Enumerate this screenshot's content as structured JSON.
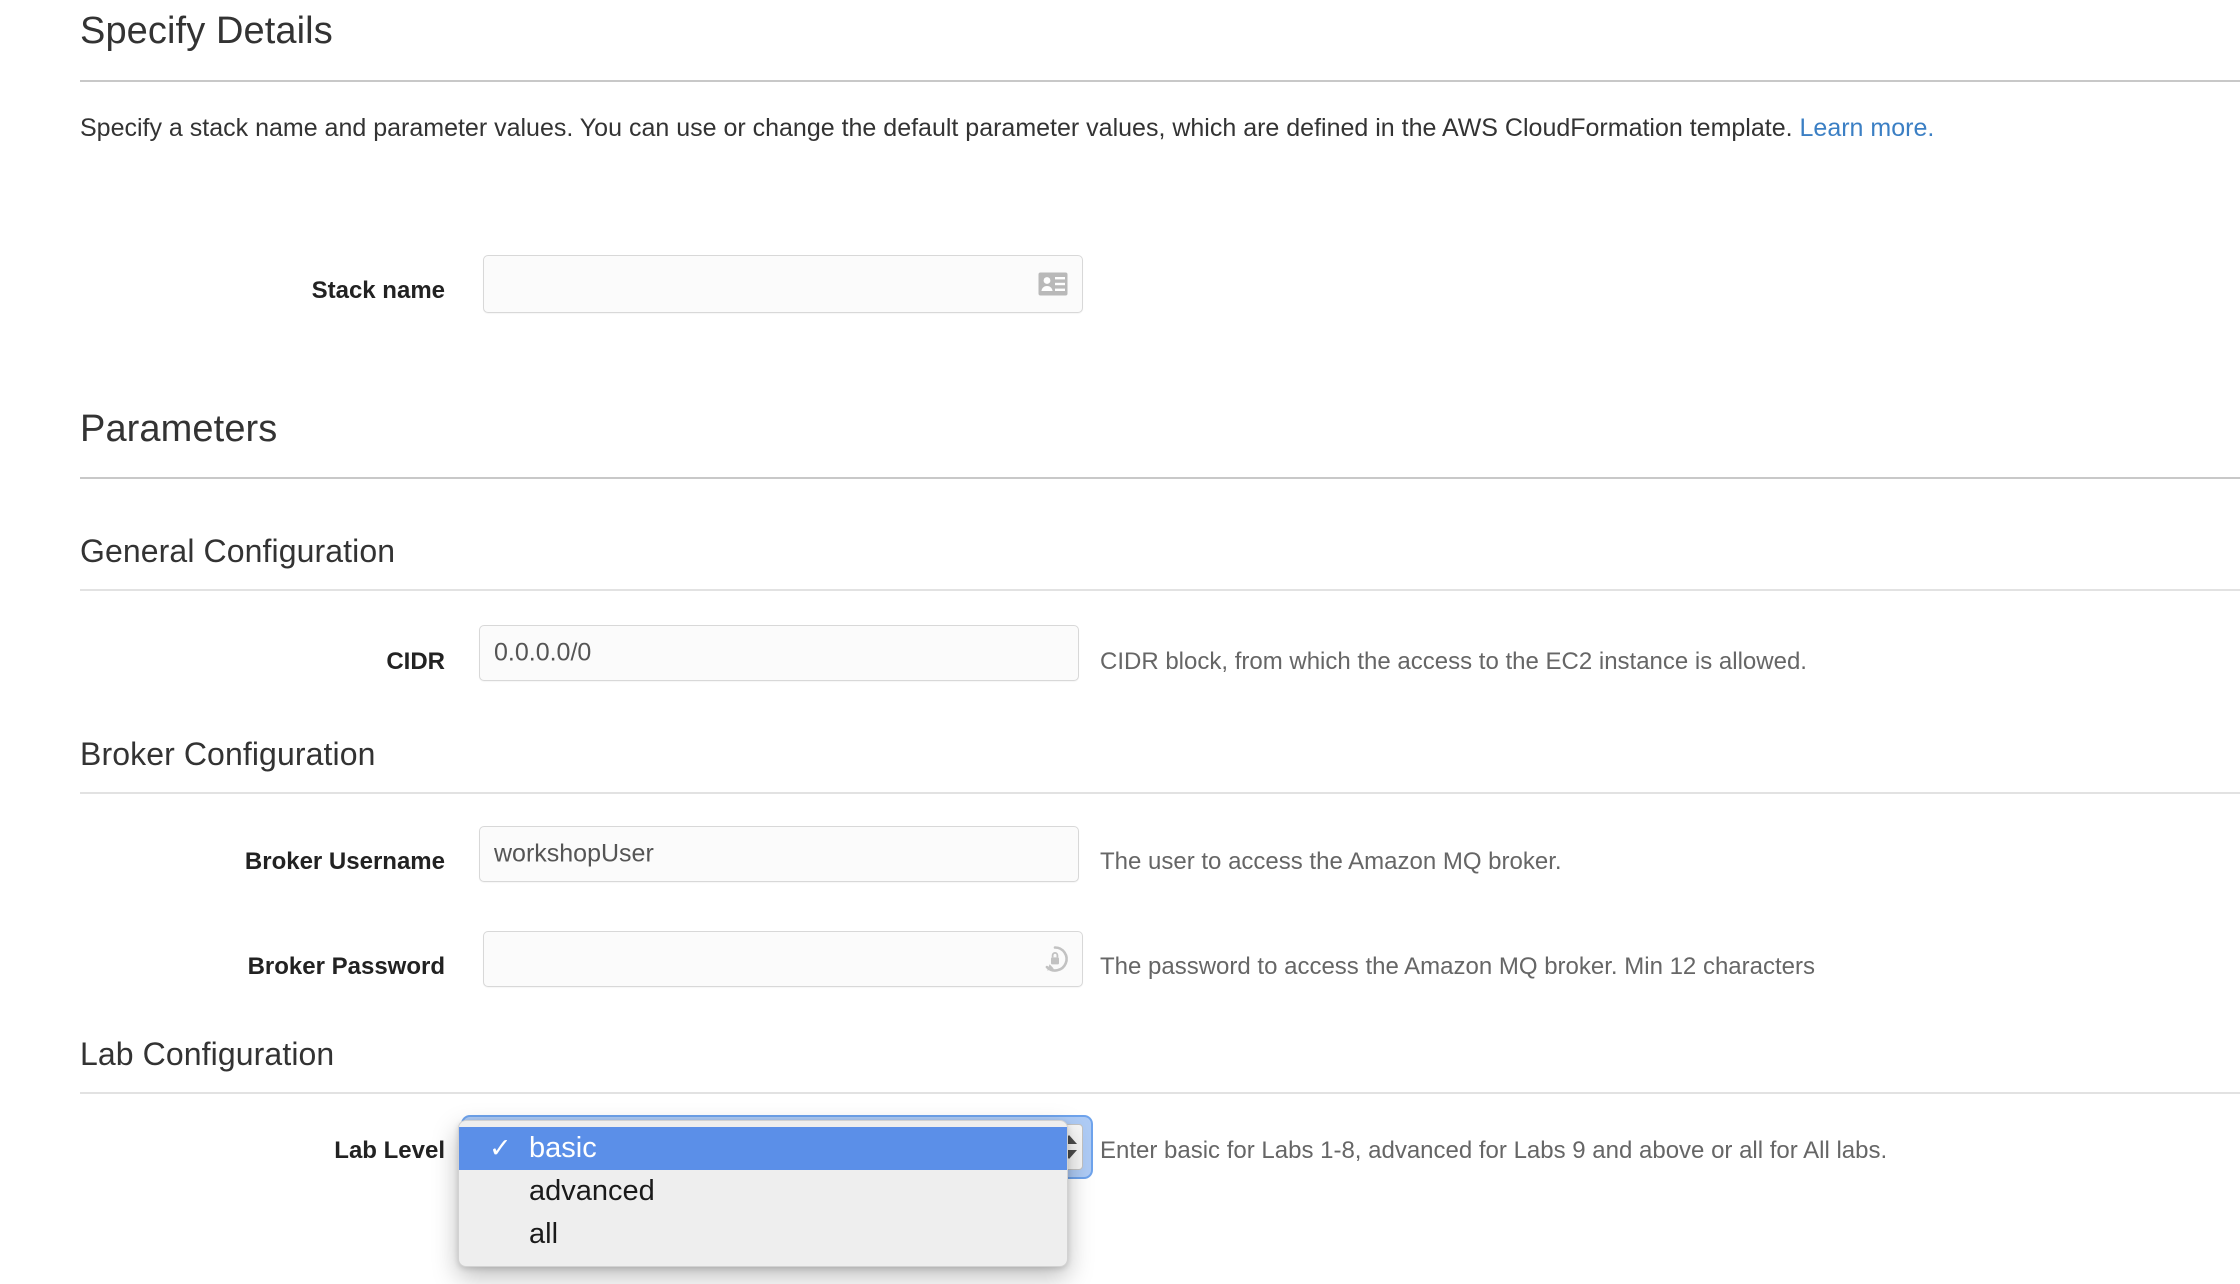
{
  "header": {
    "title": "Specify Details",
    "description_before_link": "Specify a stack name and parameter values. You can use or change the default parameter values, which are defined in the AWS CloudFormation template. ",
    "learn_more_label": "Learn more."
  },
  "stack_name": {
    "label": "Stack name",
    "value": "",
    "placeholder": "",
    "icon": "contact-card-icon"
  },
  "parameters": {
    "title": "Parameters",
    "sections": [
      {
        "title": "General Configuration",
        "fields": [
          {
            "label": "CIDR",
            "value": "0.0.0.0/0",
            "help": "CIDR block, from which the access to the EC2 instance is allowed.",
            "type": "text",
            "icon": ""
          }
        ]
      },
      {
        "title": "Broker Configuration",
        "fields": [
          {
            "label": "Broker Username",
            "value": "workshopUser",
            "help": "The user to access the Amazon MQ broker.",
            "type": "text",
            "icon": ""
          },
          {
            "label": "Broker Password",
            "value": "",
            "help": "The password to access the Amazon MQ broker. Min 12 characters",
            "type": "password",
            "icon": "password-key-icon"
          }
        ]
      },
      {
        "title": "Lab Configuration",
        "fields": [
          {
            "label": "Lab Level",
            "value": "basic",
            "help": "Enter basic for Labs 1-8, advanced for Labs 9 and above or all for All labs.",
            "type": "select",
            "icon": "stepper-arrows-icon"
          }
        ]
      }
    ]
  },
  "lab_level_dropdown": {
    "expanded": true,
    "selected": "basic",
    "checkmark": "✓",
    "options": [
      {
        "label": "basic",
        "selected": true
      },
      {
        "label": "advanced",
        "selected": false
      },
      {
        "label": "all",
        "selected": false
      }
    ]
  },
  "colors": {
    "link": "#3b7fc4",
    "selection": "#5b8fe8",
    "focus_ring": "#6ea3ec",
    "text": "#333333",
    "muted_text": "#666666",
    "field_border": "#d8d8d8",
    "rule": "#c8c8c8"
  }
}
